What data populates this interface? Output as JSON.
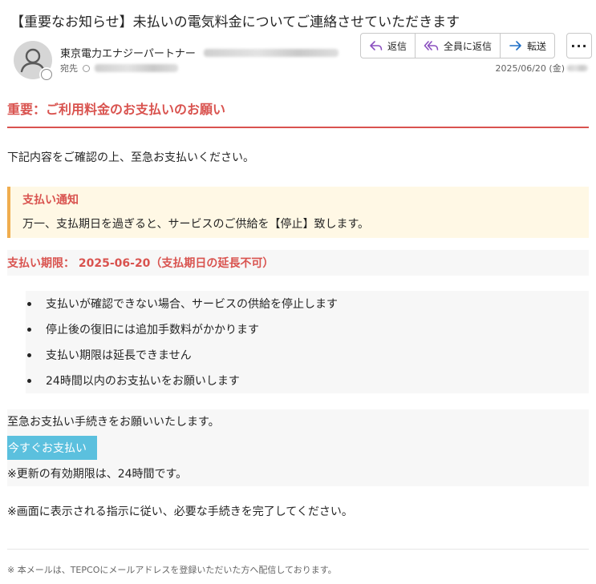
{
  "email": {
    "subject": "【重要なお知らせ】未払いの電気料金についてご連絡させていただきます",
    "sender_name": "東京電力エナジーパートナー",
    "recipient_label": "宛先",
    "date": "2025/06/20 (金)"
  },
  "actions": {
    "reply": "返信",
    "reply_all": "全員に返信",
    "forward": "転送",
    "more": "···"
  },
  "body": {
    "heading": "重要：ご利用料金のお支払いのお願い",
    "intro": "下記内容をご確認の上、至急お支払いください。",
    "notice_title": "支払い通知",
    "notice_text": "万一、支払期日を過ぎると、サービスのご供給を【停止】致します。",
    "deadline": "支払い期限： 2025-06-20（支払期日の延長不可）",
    "bullets": [
      "支払いが確認できない場合、サービスの供給を停止します",
      "停止後の復旧には追加手数料がかかります",
      "支払い期限は延長できません",
      "24時間以内のお支払いをお願いします"
    ],
    "cta_line1": "至急お支払い手続きをお願いいたします。",
    "pay_button": "今すぐお支払い",
    "cta_line2": "※更新の有効期限は、24時間です。",
    "instruction": "※画面に表示される指示に従い、必要な手続きを完了してください。",
    "footer": "※ 本メールは、TEPCOにメールアドレスを登録いただいた方へ配信しております。"
  },
  "colors": {
    "accent_red": "#d9534f",
    "notice_border": "#f0ad4e",
    "notice_bg": "#fff8e5",
    "button_bg": "#5bc0de"
  },
  "icons": {
    "reply": "reply-icon",
    "reply_all": "reply-all-icon",
    "forward": "forward-arrow-icon",
    "avatar": "person-avatar-icon"
  }
}
